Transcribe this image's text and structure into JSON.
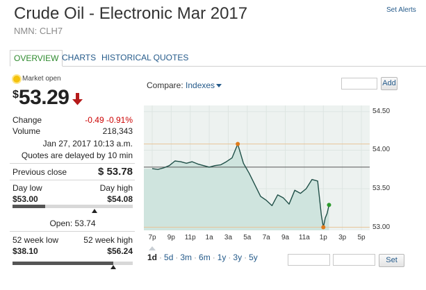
{
  "header": {
    "title": "Crude Oil - Electronic Mar 2017",
    "subtitle": "NMN: CLH7",
    "alerts_link": "Set Alerts"
  },
  "tabs": [
    {
      "label": "OVERVIEW",
      "active": true
    },
    {
      "label": "CHARTS",
      "active": false
    },
    {
      "label": "HISTORICAL QUOTES",
      "active": false
    }
  ],
  "quote": {
    "market_status": "Market open",
    "currency_symbol": "$",
    "price": "53.29",
    "direction_icon": "down-arrow-icon",
    "change_label": "Change",
    "change_value": "-0.49 -0.91%",
    "volume_label": "Volume",
    "volume_value": "218,343",
    "timestamp": "Jan 27, 2017 10:13 a.m.",
    "delay_note": "Quotes are delayed by 10 min",
    "prev_close_label": "Previous close",
    "prev_close_value": "$ 53.78",
    "day_low_label": "Day low",
    "day_high_label": "Day high",
    "day_low_value": "$53.00",
    "day_high_value": "$54.08",
    "open_text": "Open: 53.74",
    "week52_low_label": "52 week low",
    "week52_high_label": "52 week high",
    "week52_low_value": "$38.10",
    "week52_high_value": "$56.24",
    "day_range_position": 0.27,
    "open_position": 0.68,
    "week52_range_position": 0.84
  },
  "chart_controls": {
    "compare_label": "Compare:",
    "compare_value": "Indexes",
    "add_button": "Add",
    "set_button": "Set",
    "periods": [
      "1d",
      "5d",
      "3m",
      "6m",
      "1y",
      "3y",
      "5y"
    ],
    "active_period": "1d"
  },
  "chart_data": {
    "type": "area",
    "x_ticks": [
      "7p",
      "9p",
      "11p",
      "1a",
      "3a",
      "5a",
      "7a",
      "9a",
      "11a",
      "1p",
      "3p",
      "5p"
    ],
    "y_ticks": [
      "54.50",
      "54.00",
      "53.50",
      "53.00"
    ],
    "ylim": [
      52.96,
      54.58
    ],
    "previous_close": 53.78,
    "day_high_marker": 54.08,
    "day_low_marker": 53.0,
    "x": [
      0,
      0.3,
      0.6,
      0.9,
      1.2,
      1.5,
      1.8,
      2.1,
      2.4,
      2.7,
      3.0,
      3.3,
      3.6,
      3.9,
      4.2,
      4.5,
      4.8,
      5.1,
      5.4,
      5.7,
      6.0,
      6.3,
      6.6,
      6.9,
      7.2,
      7.5,
      7.8,
      8.1,
      8.4,
      8.7,
      8.9,
      9.0,
      9.1,
      9.2,
      9.3
    ],
    "values": [
      53.76,
      53.75,
      53.77,
      53.8,
      53.86,
      53.85,
      53.83,
      53.85,
      53.82,
      53.8,
      53.78,
      53.8,
      53.81,
      53.85,
      53.9,
      54.08,
      53.83,
      53.7,
      53.55,
      53.4,
      53.35,
      53.28,
      53.42,
      53.38,
      53.3,
      53.48,
      53.44,
      53.5,
      53.62,
      53.6,
      53.15,
      53.0,
      53.12,
      53.18,
      53.29
    ]
  }
}
